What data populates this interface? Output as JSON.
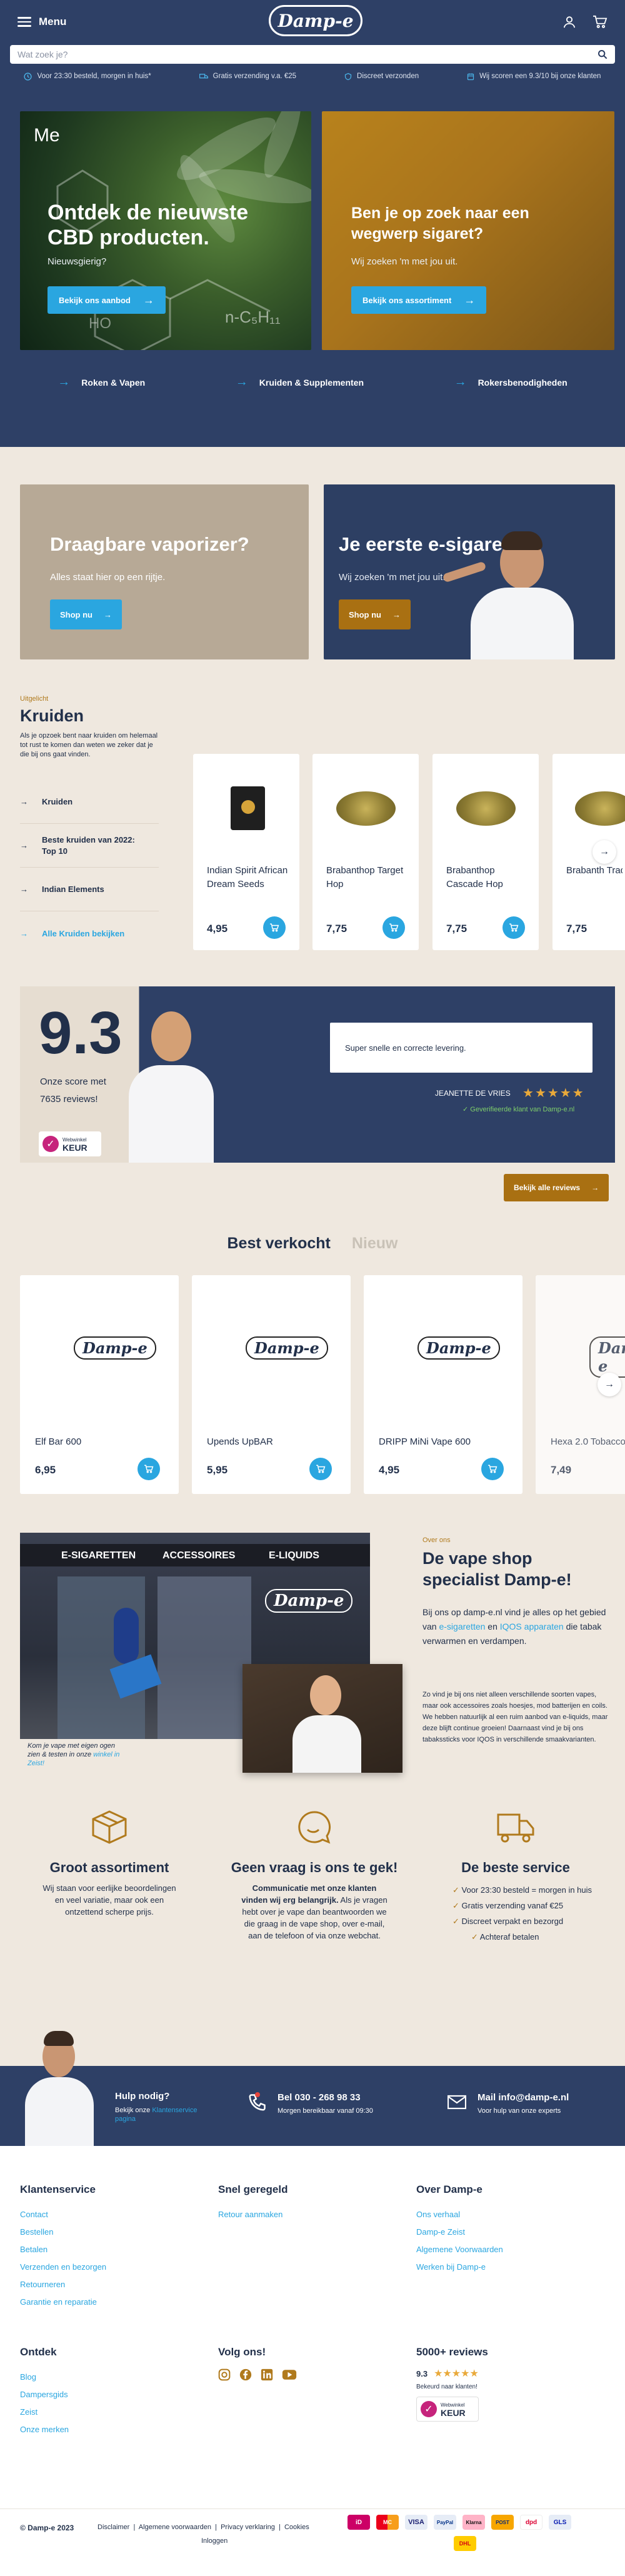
{
  "header": {
    "menu_label": "Menu",
    "logo_text": "Damp-e",
    "search_placeholder": "Wat zoek je?",
    "usps": [
      {
        "text": "Voor 23:30 besteld, morgen in huis*"
      },
      {
        "text": "Gratis verzending v.a. €25"
      },
      {
        "text": "Discreet verzonden"
      },
      {
        "text": "Wij scoren een 9.3/10 bij onze klanten"
      }
    ]
  },
  "hero": {
    "left": {
      "tag": "Me",
      "title": "Ontdek de nieuwste CBD producten.",
      "subtitle": "Nieuwsgierig?",
      "button": "Bekijk ons aanbod",
      "chem": "n-C₅H₁₁",
      "ho": "HO"
    },
    "right": {
      "title": "Ben je op zoek naar een wegwerp sigaret?",
      "subtitle": "Wij zoeken 'm met jou uit.",
      "button": "Bekijk ons assortiment"
    }
  },
  "categories": [
    "Roken & Vapen",
    "Kruiden & Supplementen",
    "Rokersbenodigheden"
  ],
  "promos": {
    "left": {
      "title": "Draagbare vaporizer?",
      "subtitle": "Alles staat hier op een rijtje.",
      "button": "Shop nu"
    },
    "right": {
      "title": "Je eerste e-sigaret?",
      "subtitle": "Wij zoeken 'm met jou uit.",
      "button": "Shop nu"
    }
  },
  "kruiden": {
    "eyebrow": "Uitgelicht",
    "title": "Kruiden",
    "description": "Als je opzoek bent naar kruiden om helemaal tot rust te komen dan weten we zeker dat je die bij ons gaat vinden.",
    "links": [
      "Kruiden",
      "Beste kruiden van 2022: Top 10",
      "Indian Elements"
    ],
    "all_link": "Alle Kruiden bekijken",
    "products": [
      {
        "name": "Indian Spirit African Dream Seeds",
        "price": "4,95"
      },
      {
        "name": "Brabanthop Target Hop",
        "price": "7,75"
      },
      {
        "name": "Brabanthop Cascade Hop",
        "price": "7,75"
      },
      {
        "name": "Brabanth Tradition",
        "price": "7,75"
      }
    ]
  },
  "score": {
    "value": "9.3",
    "label_line1": "Onze score met",
    "label_line2": "7635 reviews!",
    "review_text": "Super snelle en correcte levering.",
    "reviewer": "JEANETTE DE VRIES",
    "verified": "Geverifieerde klant van Damp-e.nl",
    "badge_top": "Webwinkel",
    "badge_bottom": "KEUR",
    "button": "Bekijk alle reviews",
    "stars": 5
  },
  "bestsellers": {
    "tab_active": "Best verkocht",
    "tab_inactive": "Nieuw",
    "products": [
      {
        "name": "Elf Bar 600",
        "price": "6,95",
        "logo": "Damp-e"
      },
      {
        "name": "Upends UpBAR",
        "price": "5,95",
        "logo": "Damp-e"
      },
      {
        "name": "DRIPP MiNi Vape 600",
        "price": "4,95",
        "logo": "Damp-e"
      },
      {
        "name": "Hexa 2.0 Tobacco",
        "price": "7,49",
        "logo": "Damp-e"
      }
    ]
  },
  "about": {
    "eyebrow": "Over ons",
    "title": "De vape shop specialist Damp-e!",
    "para1_a": "Bij ons op damp-e.nl vind je alles op het gebied van ",
    "para1_link1": "e-sigaretten",
    "para1_b": " en ",
    "para1_link2": "IQOS apparaten",
    "para1_c": " die tabak verwarmen en verdampen.",
    "para2": "Zo vind je bij ons niet alleen verschillende soorten vapes, maar ook accessoires zoals hoesjes, mod batterijen en coils. We hebben natuurlijk al een ruim aanbod van e-liquids, maar deze blijft continue groeien! Daarnaast vind je bij ons tabakssticks voor IQOS in verschillende smaakvarianten.",
    "store_signs": [
      "E-SIGARETTEN",
      "ACCESSOIRES",
      "E-LIQUIDS"
    ],
    "store_logo": "Damp-e",
    "caption_a": "Kom je vape met eigen ogen zien & testen in onze ",
    "caption_link": "winkel in Zeist!"
  },
  "features": [
    {
      "title": "Groot assortiment",
      "text": "Wij staan voor eerlijke beoordelingen en veel variatie, maar ook een ontzettend scherpe prijs."
    },
    {
      "title": "Geen vraag is ons te gek!",
      "bold": "Communicatie met onze klanten vinden wij erg belangrijk.",
      "text": "Als je vragen hebt over je vape dan beantwoorden we die graag in de vape shop, over e-mail, aan de telefoon of via onze webchat."
    },
    {
      "title": "De beste service",
      "list": [
        "Voor 23:30 besteld = morgen in huis",
        "Gratis verzending vanaf €25",
        "Discreet verpakt en bezorgd",
        "Achteraf betalen"
      ]
    }
  ],
  "help": {
    "title": "Hulp nodig?",
    "text_a": "Bekijk onze ",
    "text_link": "Klantenservice pagina",
    "phone": "Bel 030 - 268 98 33",
    "phone_sub": "Morgen bereikbaar vanaf 09:30",
    "mail": "Mail info@damp-e.nl",
    "mail_sub": "Voor hulp van onze experts"
  },
  "footer": {
    "col1": {
      "title": "Klantenservice",
      "links": [
        "Contact",
        "Bestellen",
        "Betalen",
        "Verzenden en bezorgen",
        "Retourneren",
        "Garantie en reparatie"
      ]
    },
    "col2": {
      "title": "Snel geregeld",
      "links": [
        "Retour aanmaken"
      ]
    },
    "col3": {
      "title": "Over Damp-e",
      "links": [
        "Ons verhaal",
        "Damp-e Zeist",
        "Algemene Voorwaarden",
        "Werken bij Damp-e"
      ]
    },
    "col4": {
      "title": "Ontdek",
      "links": [
        "Blog",
        "Dampersgids",
        "Zeist",
        "Onze merken"
      ]
    },
    "social_title": "Volg ons!",
    "reviews_title": "5000+ reviews",
    "reviews_score": "9.3",
    "reviews_sub": "Bekeurd naar klanten!",
    "badge_top": "Webwinkel",
    "badge_bottom": "KEUR",
    "copyright": "© Damp-e 2023",
    "legal": "Disclaimer  |  Algemene voorwaarden  |  Privacy verklaring  |  Cookies",
    "login": "Inloggen",
    "payments": [
      "iD",
      "MC",
      "VISA",
      "PayPal",
      "Klarna",
      "POST",
      "dpd",
      "GLS",
      "DHL"
    ]
  }
}
